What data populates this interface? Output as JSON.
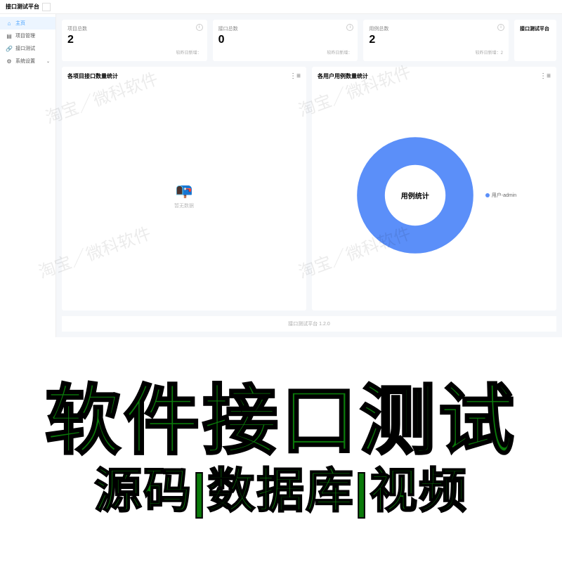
{
  "header": {
    "title": "接口测试平台"
  },
  "sidebar": {
    "items": [
      {
        "icon": "⌂",
        "label": "主页",
        "active": true
      },
      {
        "icon": "▤",
        "label": "项目管理"
      },
      {
        "icon": "🔗",
        "label": "接口测试"
      },
      {
        "icon": "⚙",
        "label": "系统设置",
        "expandable": true
      }
    ]
  },
  "stats": [
    {
      "label": "项目总数",
      "value": "2",
      "footer": "较昨日新增："
    },
    {
      "label": "接口总数",
      "value": "0",
      "footer": "较昨日新增："
    },
    {
      "label": "用例总数",
      "value": "2",
      "footer": "较昨日新增：2"
    }
  ],
  "rightPanel": {
    "title": "接口测试平台"
  },
  "charts": {
    "left": {
      "title": "各项目接口数量统计",
      "empty": "暂无数据"
    },
    "right": {
      "title": "各用户用例数量统计",
      "center": "用例统计",
      "legend": "用户-admin"
    }
  },
  "chart_data": {
    "type": "pie",
    "title": "用例统计",
    "series": [
      {
        "name": "用户-admin",
        "value": 2,
        "color": "#5b8ff9"
      }
    ]
  },
  "footer": {
    "text": "接口测试平台 1.2.0"
  },
  "watermark": "淘宝／微科软件",
  "promo": {
    "line1": "软件接口测试",
    "line2": "源码|数据库|视频"
  }
}
